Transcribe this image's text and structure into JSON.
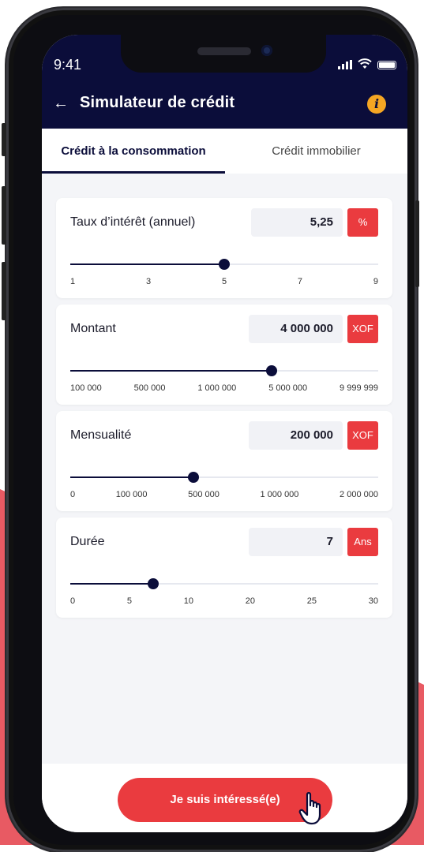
{
  "status": {
    "time": "9:41"
  },
  "header": {
    "title": "Simulateur de crédit",
    "back_icon": "arrow-left-icon",
    "info_icon": "i"
  },
  "tabs": [
    {
      "label": "Crédit à la consommation",
      "active": true
    },
    {
      "label": "Crédit immobilier",
      "active": false
    }
  ],
  "fields": [
    {
      "label": "Taux d’intérêt (annuel)",
      "value": "5,25",
      "unit": "%",
      "slider_fraction": 0.5,
      "ticks": [
        "1",
        "3",
        "5",
        "7",
        "9"
      ]
    },
    {
      "label": "Montant",
      "value": "4 000 000",
      "unit": "XOF",
      "slider_fraction": 0.655,
      "ticks": [
        "100 000",
        "500 000",
        "1 000 000",
        "5 000 000",
        "9 999 999"
      ]
    },
    {
      "label": "Mensualité",
      "value": "200 000",
      "unit": "XOF",
      "slider_fraction": 0.4,
      "ticks": [
        "0",
        "100 000",
        "500 000",
        "1 000 000",
        "2 000 000"
      ]
    },
    {
      "label": "Durée",
      "value": "7",
      "unit": "Ans",
      "slider_fraction": 0.27,
      "ticks": [
        "0",
        "5",
        "10",
        "20",
        "25",
        "30"
      ]
    }
  ],
  "footer": {
    "cta_label": "Je suis intéressé(e)"
  },
  "colors": {
    "navy": "#0b0d3a",
    "accent": "#ea3b3f",
    "info": "#f5a623",
    "background_blob": "#e85a63"
  }
}
